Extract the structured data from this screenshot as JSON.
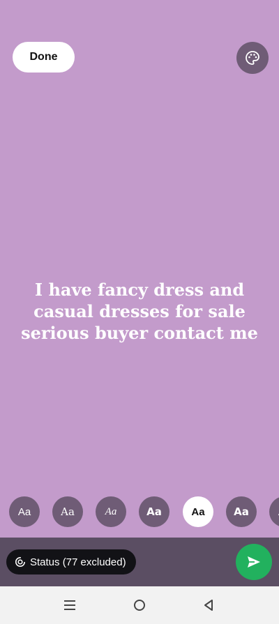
{
  "header": {
    "done_label": "Done",
    "palette_icon": "palette-icon"
  },
  "status_text": {
    "line1": "I have fancy dress and",
    "line2": "casual dresses for sale",
    "line3": "serious buyer contact me",
    "color": "#ffffff"
  },
  "font_picker": {
    "chips": [
      {
        "label": "Aa",
        "style": "sans"
      },
      {
        "label": "Aa",
        "style": "serif"
      },
      {
        "label": "Aa",
        "style": "italic"
      },
      {
        "label": "Aa",
        "style": "rounded"
      },
      {
        "label": "Aa",
        "style": "bold",
        "selected": true
      },
      {
        "label": "Aa",
        "style": "heavy"
      },
      {
        "label": "Aa",
        "style": "partial"
      }
    ]
  },
  "footer": {
    "status_label": "Status (77 excluded)",
    "privacy_icon": "status-privacy-icon",
    "send_icon": "send-icon"
  },
  "nav": {
    "recents_icon": "recents-icon",
    "home_icon": "home-icon",
    "back_icon": "back-icon"
  },
  "colors": {
    "background": "#c39bcb",
    "chip": "#6f5c76",
    "bottom_bar": "#5b4e63",
    "send": "#22b15e"
  }
}
